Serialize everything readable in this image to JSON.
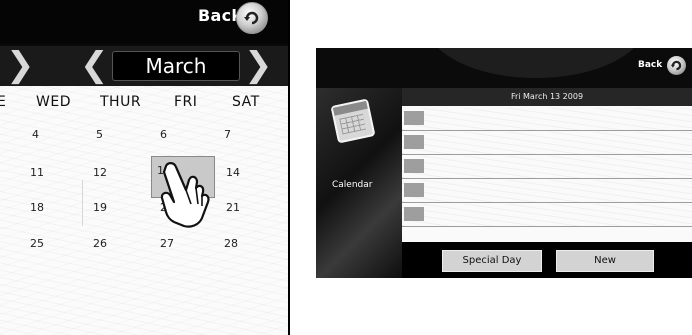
{
  "zoom_view": {
    "back_label": "Back",
    "month": "March",
    "day_names": [
      "E",
      "WED",
      "THUR",
      "FRI",
      "SAT"
    ],
    "weeks": [
      [
        "4",
        "5",
        "6",
        "7"
      ],
      [
        "11",
        "12",
        "13",
        "14"
      ],
      [
        "18",
        "19",
        "20",
        "21"
      ],
      [
        "25",
        "26",
        "27",
        "28"
      ]
    ],
    "selected_day": "13"
  },
  "device": {
    "back_label": "Back",
    "sidebar_label": "Calendar",
    "date_header": "Fri March 13 2009",
    "buttons": {
      "special_day": "Special Day",
      "new": "New"
    }
  },
  "icons": [
    "back-arrow-icon",
    "chevron-left-icon",
    "chevron-right-icon",
    "pointing-hand-icon",
    "calendar-icon"
  ]
}
